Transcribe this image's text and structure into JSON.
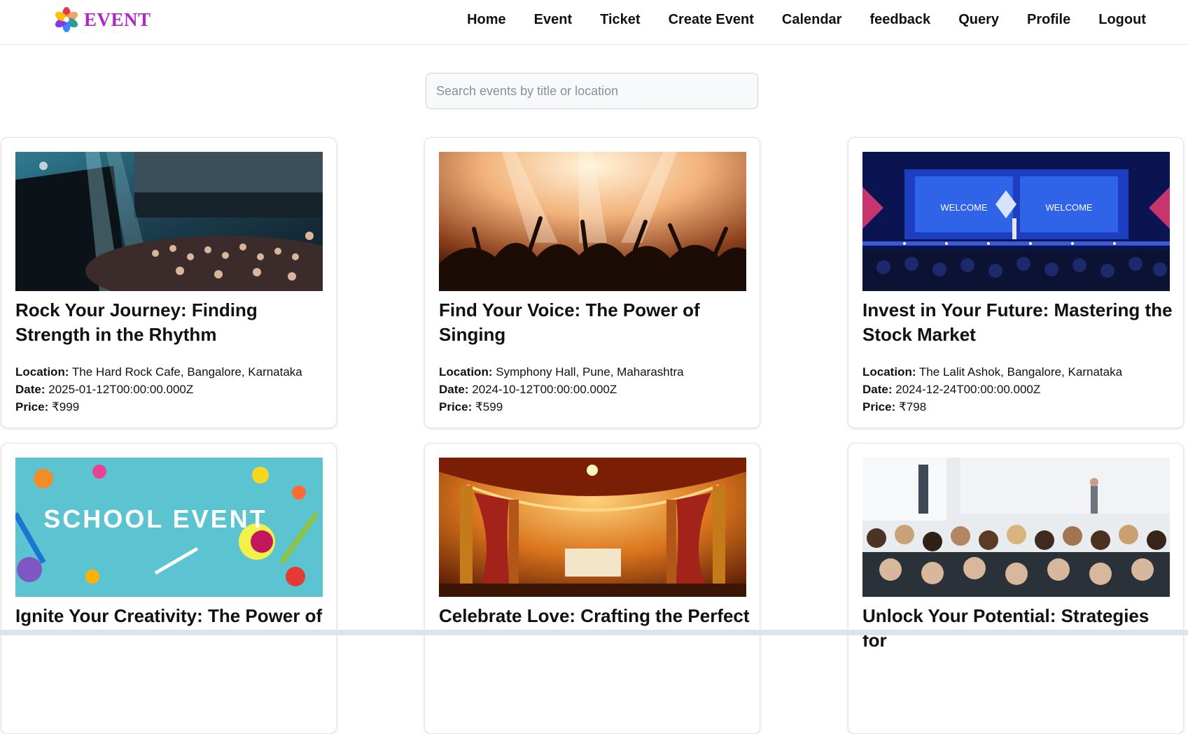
{
  "brand": {
    "name": "EVENT",
    "logo_icon": "flower-logo-icon",
    "color": "#b026c9"
  },
  "nav": {
    "items": [
      "Home",
      "Event",
      "Ticket",
      "Create Event",
      "Calendar",
      "feedback",
      "Query",
      "Profile",
      "Logout"
    ]
  },
  "search": {
    "placeholder": "Search events by title or location",
    "value": ""
  },
  "labels": {
    "location": "Location:",
    "date": "Date:",
    "price": "Price:"
  },
  "events": [
    {
      "title": "Rock Your Journey: Finding Strength in the Rhythm",
      "location": "The Hard Rock Cafe, Bangalore, Karnataka",
      "date": "2025-01-12T00:00:00.000Z",
      "price": "₹999",
      "image_icon": "concert-crowd-image"
    },
    {
      "title": "Find Your Voice: The Power of Singing",
      "location": "Symphony Hall, Pune, Maharashtra",
      "date": "2024-10-12T00:00:00.000Z",
      "price": "₹599",
      "image_icon": "stage-lights-crowd-image"
    },
    {
      "title": "Invest in Your Future: Mastering the Stock Market",
      "location": "The Lalit Ashok, Bangalore, Karnataka",
      "date": "2024-12-24T00:00:00.000Z",
      "price": "₹798",
      "image_icon": "conference-stage-image",
      "image_text": [
        "WELCOME",
        "WELCOME"
      ]
    },
    {
      "title": "Ignite Your Creativity: The Power of",
      "location": "",
      "date": "",
      "price": "",
      "image_icon": "school-event-art-image",
      "image_text": [
        "SCHOOL EVENT"
      ]
    },
    {
      "title": "Celebrate Love: Crafting the Perfect",
      "location": "",
      "date": "",
      "price": "",
      "image_icon": "wedding-mandap-image"
    },
    {
      "title": "Unlock Your Potential: Strategies for",
      "location": "",
      "date": "",
      "price": "",
      "image_icon": "seminar-audience-image"
    }
  ]
}
